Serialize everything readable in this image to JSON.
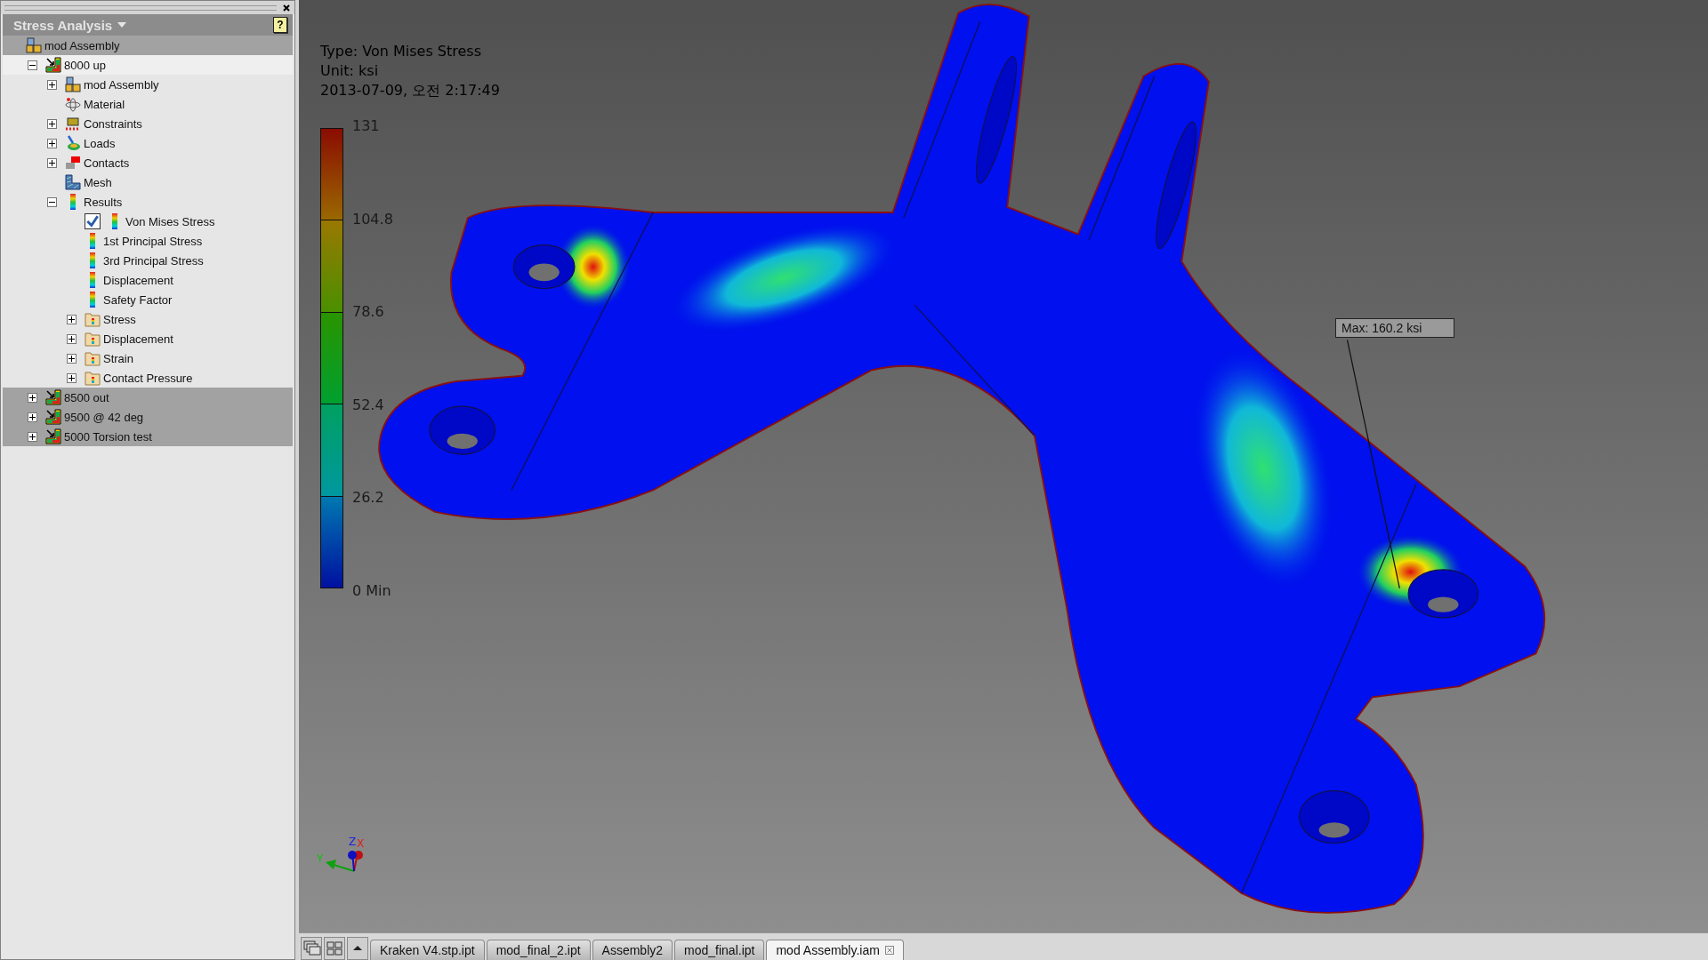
{
  "browser": {
    "title": "Stress Analysis",
    "help": "?",
    "tree": [
      {
        "label": "mod Assembly",
        "kind": "assembly",
        "children": [
          {
            "label": "8000 up",
            "kind": "analysis",
            "expanded": true,
            "active": true,
            "children": [
              {
                "label": "mod Assembly",
                "kind": "assembly",
                "expanded": false
              },
              {
                "label": "Material",
                "kind": "material"
              },
              {
                "label": "Constraints",
                "kind": "constraints",
                "expanded": false
              },
              {
                "label": "Loads",
                "kind": "loads",
                "expanded": false
              },
              {
                "label": "Contacts",
                "kind": "contacts",
                "expanded": false
              },
              {
                "label": "Mesh",
                "kind": "mesh"
              },
              {
                "label": "Results",
                "kind": "results",
                "expanded": true,
                "children": [
                  {
                    "label": "Von Mises Stress",
                    "kind": "result",
                    "checked": true
                  },
                  {
                    "label": "1st Principal Stress",
                    "kind": "result"
                  },
                  {
                    "label": "3rd Principal Stress",
                    "kind": "result"
                  },
                  {
                    "label": "Displacement",
                    "kind": "result"
                  },
                  {
                    "label": "Safety Factor",
                    "kind": "result"
                  },
                  {
                    "label": "Stress",
                    "kind": "folder",
                    "expanded": false
                  },
                  {
                    "label": "Displacement",
                    "kind": "folder",
                    "expanded": false
                  },
                  {
                    "label": "Strain",
                    "kind": "folder",
                    "expanded": false
                  },
                  {
                    "label": "Contact Pressure",
                    "kind": "folder",
                    "expanded": false
                  }
                ]
              }
            ]
          },
          {
            "label": "8500 out",
            "kind": "analysis",
            "expanded": false,
            "active": false
          },
          {
            "label": "9500 @ 42 deg",
            "kind": "analysis",
            "expanded": false,
            "active": false
          },
          {
            "label": "5000 Torsion test",
            "kind": "analysis",
            "expanded": false,
            "active": false
          }
        ]
      }
    ]
  },
  "viewport": {
    "type": "Type: Von Mises Stress",
    "unit": "Unit: ksi",
    "date": "2013-07-09, 오전 2:17:49",
    "legend_labels": [
      "131",
      "104.8",
      "78.6",
      "52.4",
      "26.2",
      "0 Min"
    ],
    "max_probe": "Max: 160.2 ksi",
    "axes": {
      "x": "X",
      "y": "Y",
      "z": "Z"
    }
  },
  "document_tabs": [
    {
      "label": "Kraken V4.stp.ipt",
      "selected": false
    },
    {
      "label": "mod_final_2.ipt",
      "selected": false
    },
    {
      "label": "Assembly2",
      "selected": false
    },
    {
      "label": "mod_final.ipt",
      "selected": false
    },
    {
      "label": "mod Assembly.iam",
      "selected": true
    }
  ]
}
